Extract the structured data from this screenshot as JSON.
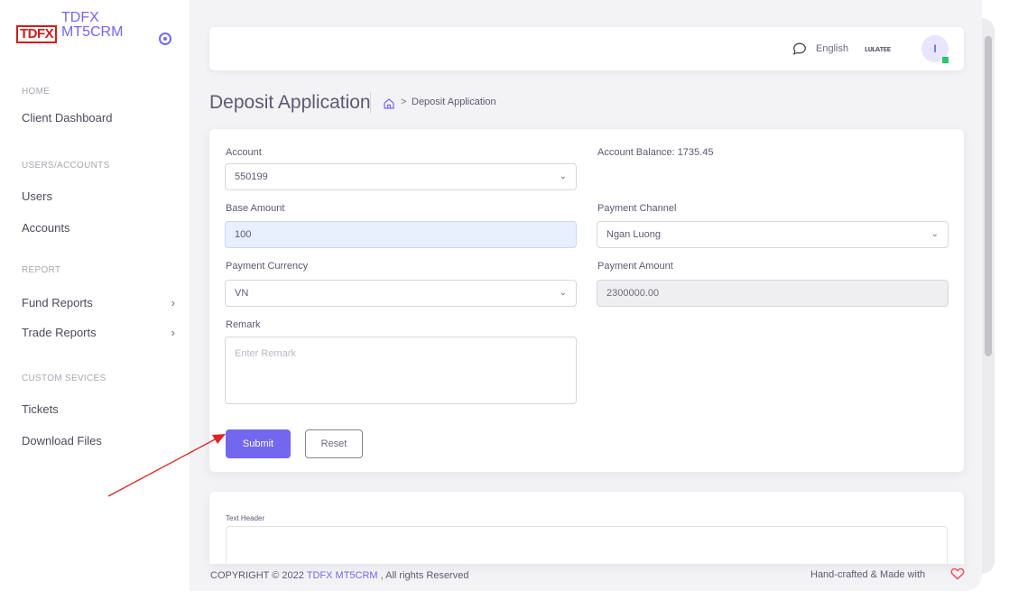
{
  "brand": {
    "logo": "TDFX",
    "name_line1": "TDFX",
    "name_line2": "MT5CRM"
  },
  "sidebar": {
    "sections": [
      {
        "header": "HOME",
        "items": [
          {
            "label": "Client Dashboard"
          }
        ]
      },
      {
        "header": "USERS/ACCOUNTS",
        "items": [
          {
            "label": "Users"
          },
          {
            "label": "Accounts"
          }
        ]
      },
      {
        "header": "REPORT",
        "items": [
          {
            "label": "Fund Reports",
            "chevron": "›"
          },
          {
            "label": "Trade Reports",
            "chevron": "›"
          }
        ]
      },
      {
        "header": "CUSTOM SEVICES",
        "items": [
          {
            "label": "Tickets"
          },
          {
            "label": "Download Files"
          }
        ]
      }
    ]
  },
  "topnav": {
    "language": "English",
    "user_name": "ʟᴜʟᴀᴛᴇᴇ",
    "avatar_initial": "I",
    "status_color": "#28c76f"
  },
  "page": {
    "title": "Deposit Application",
    "breadcrumb_sep": ">",
    "breadcrumb_current": "Deposit Application"
  },
  "form": {
    "account_label": "Account",
    "account_value": "550199",
    "balance_label": "Account Balance",
    "balance_value": "1735.45",
    "base_amount_label": "Base Amount",
    "base_amount_value": "100",
    "payment_channel_label": "Payment Channel",
    "payment_channel_value": "Ngan Luong",
    "payment_currency_label": "Payment Currency",
    "payment_currency_value": "VN",
    "payment_amount_label": "Payment Amount",
    "payment_amount_value": "2300000.00",
    "remark_label": "Remark",
    "remark_placeholder": "Enter Remark",
    "submit_label": "Submit",
    "reset_label": "Reset"
  },
  "text_card": {
    "header": "Text Header"
  },
  "footer": {
    "copyright_prefix": "COPYRIGHT © 2022",
    "brand": "TDFX MT5CRM",
    "suffix": ", All rights Reserved",
    "right": "Hand-crafted & Made with"
  },
  "colors": {
    "primary": "#7367f0",
    "annotation": "#e02424",
    "heart": "#ea5455"
  }
}
